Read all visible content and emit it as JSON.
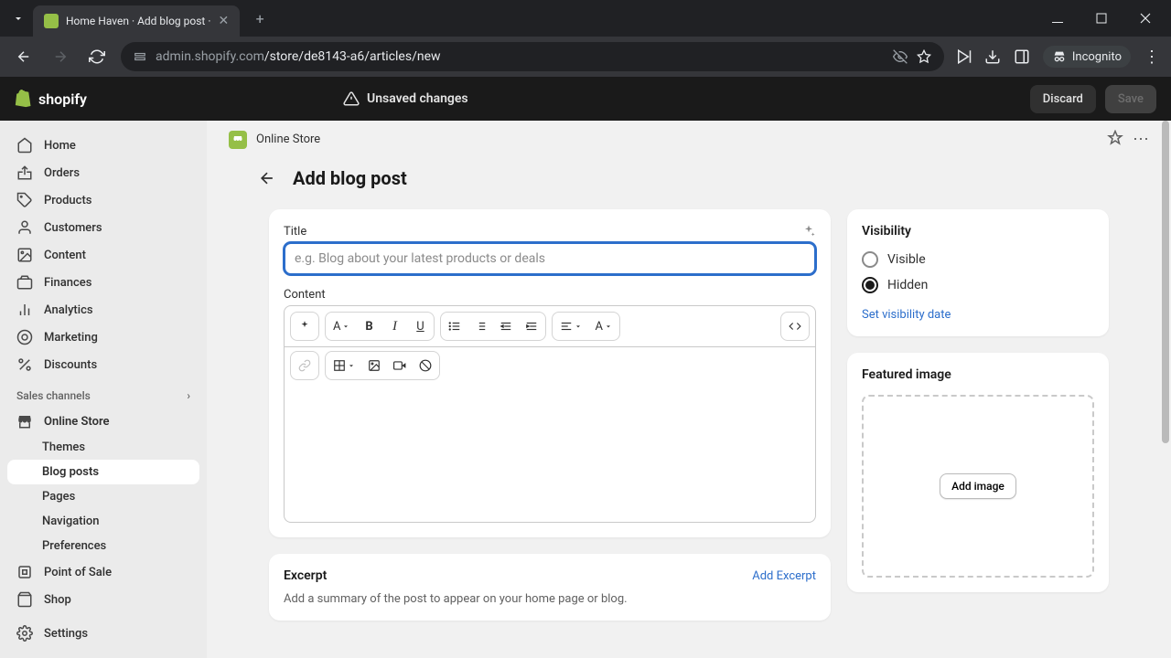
{
  "browser": {
    "tab_title": "Home Haven · Add blog post ·",
    "url_host": "admin.shopify.com",
    "url_path": "/store/de8143-a6/articles/new",
    "incognito": "Incognito"
  },
  "topbar": {
    "brand": "shopify",
    "unsaved": "Unsaved changes",
    "discard": "Discard",
    "save": "Save"
  },
  "sidebar": {
    "items": [
      {
        "label": "Home",
        "icon": "home"
      },
      {
        "label": "Orders",
        "icon": "orders"
      },
      {
        "label": "Products",
        "icon": "products"
      },
      {
        "label": "Customers",
        "icon": "customers"
      },
      {
        "label": "Content",
        "icon": "content"
      },
      {
        "label": "Finances",
        "icon": "finances"
      },
      {
        "label": "Analytics",
        "icon": "analytics"
      },
      {
        "label": "Marketing",
        "icon": "marketing"
      },
      {
        "label": "Discounts",
        "icon": "discounts"
      }
    ],
    "section": "Sales channels",
    "channels": [
      {
        "label": "Online Store",
        "sub": [
          "Themes",
          "Blog posts",
          "Pages",
          "Navigation",
          "Preferences"
        ]
      },
      {
        "label": "Point of Sale"
      },
      {
        "label": "Shop"
      }
    ],
    "settings": "Settings"
  },
  "context": {
    "label": "Online Store"
  },
  "page": {
    "title": "Add blog post",
    "field_title": "Title",
    "title_placeholder": "e.g. Blog about your latest products or deals",
    "field_content": "Content",
    "excerpt_title": "Excerpt",
    "add_excerpt": "Add Excerpt",
    "excerpt_hint": "Add a summary of the post to appear on your home page or blog."
  },
  "visibility": {
    "title": "Visibility",
    "visible": "Visible",
    "hidden": "Hidden",
    "set_date": "Set visibility date"
  },
  "featured": {
    "title": "Featured image",
    "add_image": "Add image"
  }
}
